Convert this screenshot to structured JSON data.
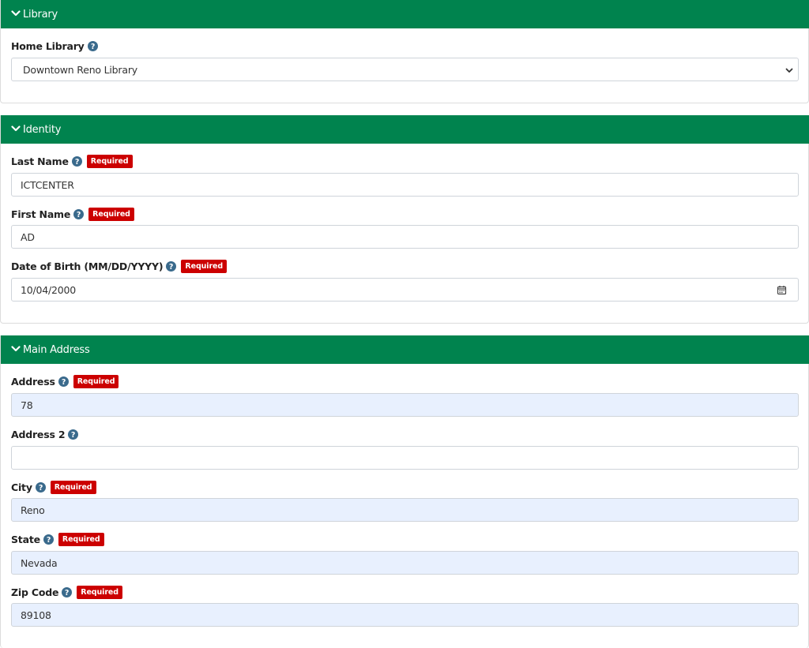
{
  "sections": {
    "library": {
      "title": "Library",
      "home_library": {
        "label": "Home Library",
        "value": "Downtown Reno Library"
      }
    },
    "identity": {
      "title": "Identity",
      "last_name": {
        "label": "Last Name",
        "required": "Required",
        "value": "ICTCENTER"
      },
      "first_name": {
        "label": "First Name",
        "required": "Required",
        "value": "AD"
      },
      "dob": {
        "label": "Date of Birth (MM/DD/YYYY)",
        "required": "Required",
        "value": "10/04/2000"
      }
    },
    "main_address": {
      "title": "Main Address",
      "address": {
        "label": "Address",
        "required": "Required",
        "value": "78"
      },
      "address2": {
        "label": "Address 2",
        "value": ""
      },
      "city": {
        "label": "City",
        "required": "Required",
        "value": "Reno"
      },
      "state": {
        "label": "State",
        "required": "Required",
        "value": "Nevada"
      },
      "zip": {
        "label": "Zip Code",
        "required": "Required",
        "value": "89108"
      }
    }
  },
  "icons": {
    "section_toggle": "chevron-down-icon",
    "help": "question-circle-icon",
    "select": "chevron-down-icon",
    "date_picker": "calendar-icon"
  },
  "colors": {
    "header_green": "#00834e",
    "required_red": "#cc0000",
    "help_blue": "#3a6a8c",
    "autofill_bg": "#e8f0fe"
  }
}
